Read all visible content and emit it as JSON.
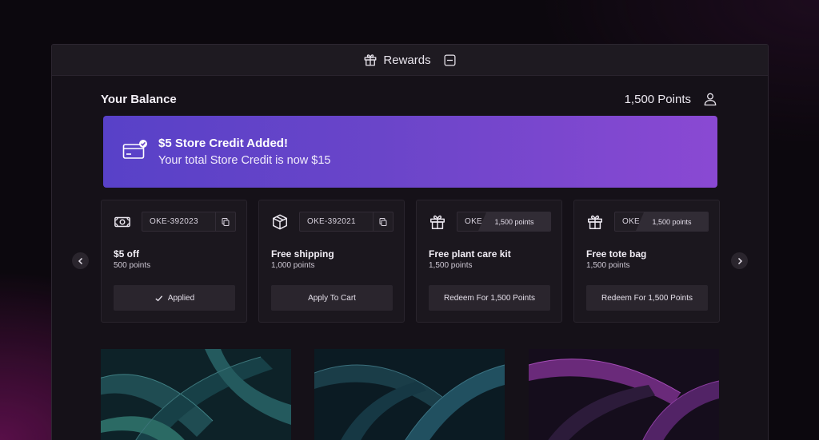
{
  "window": {
    "title": "Rewards",
    "icons": {
      "title": "gift-icon",
      "minimize": "minimize-icon"
    }
  },
  "balance": {
    "label": "Your Balance",
    "points": "1,500 Points",
    "icon": "user-icon"
  },
  "banner": {
    "heading": "$5 Store Credit Added!",
    "subtext": "Your total Store Credit is now $15",
    "icon": "credit-card-check-icon",
    "gradient_start": "#5841c8",
    "gradient_end": "#8a49d3"
  },
  "carousel": {
    "prev_icon": "chevron-left-icon",
    "next_icon": "chevron-right-icon"
  },
  "rewards": [
    {
      "icon": "cash-icon",
      "code": "OKE-392023",
      "name": "$5 off",
      "points": "500 points",
      "action": "Applied",
      "action_icon": "check-icon",
      "locked": false
    },
    {
      "icon": "package-icon",
      "code": "OKE-392021",
      "name": "Free shipping",
      "points": "1,000 points",
      "action": "Apply To Cart",
      "locked": false
    },
    {
      "icon": "gift-icon",
      "code": "OKE",
      "lock_label": "1,500 points",
      "name": "Free plant care kit",
      "points": "1,500 points",
      "action": "Redeem For 1,500 Points",
      "locked": true
    },
    {
      "icon": "gift-icon",
      "code": "OKE",
      "lock_label": "1,500 points",
      "name": "Free tote bag",
      "points": "1,500 points",
      "action": "Redeem For 1,500 Points",
      "locked": true
    }
  ],
  "gallery": [
    {
      "icon": "plant-photo"
    },
    {
      "icon": "plant-photo"
    },
    {
      "icon": "plant-photo"
    }
  ],
  "colors": {
    "background": "#0c080e",
    "window": "#151118",
    "card": "#1b171e",
    "button": "#2a252d"
  }
}
